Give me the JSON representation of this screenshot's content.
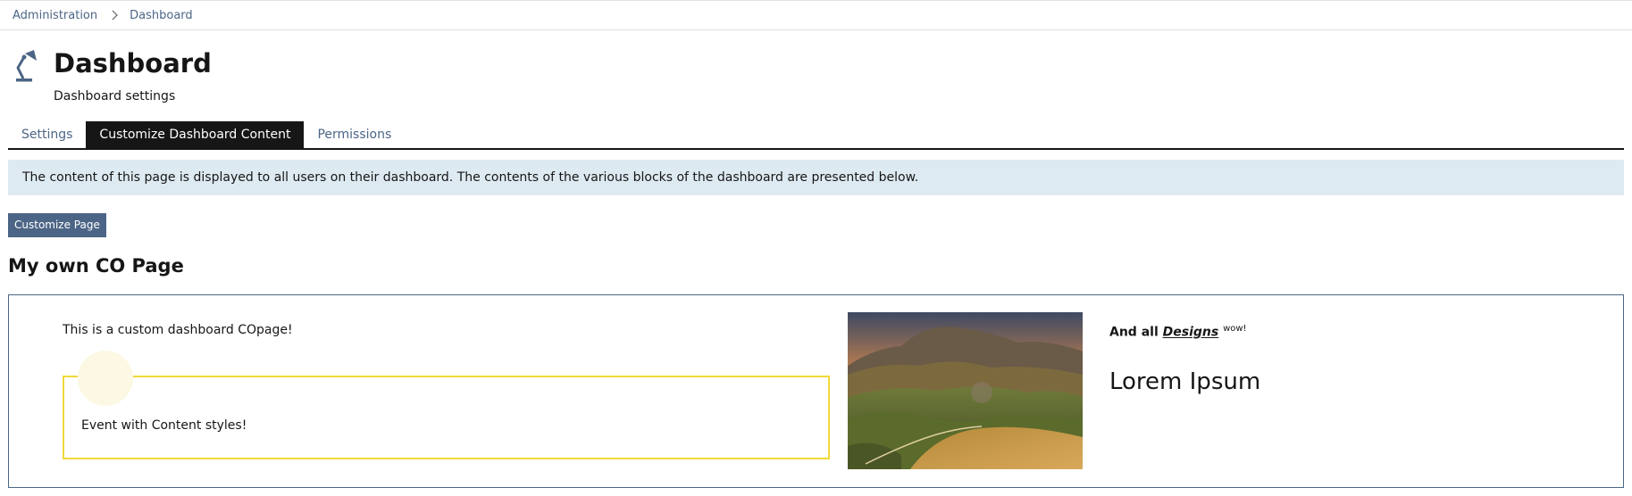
{
  "breadcrumb": {
    "items": [
      "Administration",
      "Dashboard"
    ]
  },
  "header": {
    "title": "Dashboard",
    "subtitle": "Dashboard settings",
    "icon": "desk-lamp-icon"
  },
  "tabs": [
    {
      "label": "Settings",
      "active": false
    },
    {
      "label": "Customize Dashboard Content",
      "active": true
    },
    {
      "label": "Permissions",
      "active": false
    }
  ],
  "info": {
    "text": "The content of this page is displayed to all users on their dashboard. The contents of the various blocks of the dashboard are presented below."
  },
  "actions": {
    "customize_label": "Customize Page"
  },
  "section": {
    "title": "My own CO Page"
  },
  "content": {
    "custom_text": "This is a custom dashboard COpage!",
    "event_text": "Event with Content styles!",
    "designs_prefix": "And all",
    "designs_link": "Designs",
    "designs_sup": "wow!",
    "lorem": "Lorem Ipsum"
  },
  "colors": {
    "accent": "#4c6586",
    "tab_active_bg": "#161616",
    "info_bg": "#deeaf2",
    "event_border": "#f0d93a"
  }
}
